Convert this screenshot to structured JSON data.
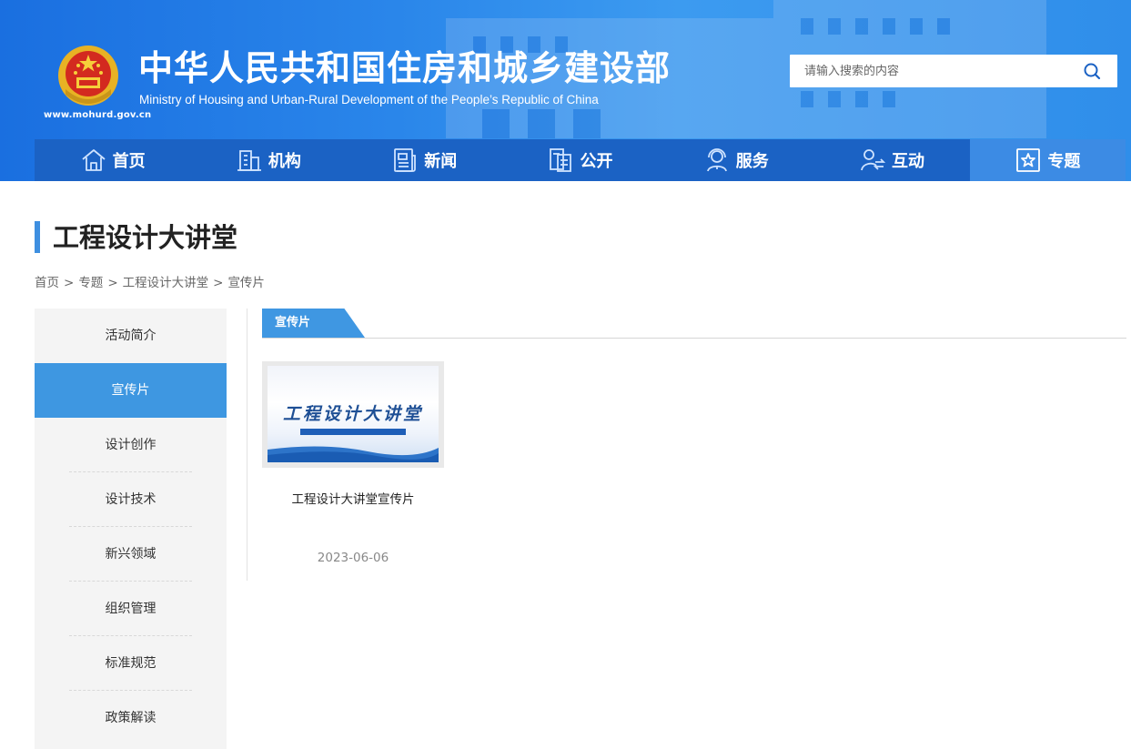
{
  "header": {
    "site_title": "中华人民共和国住房和城乡建设部",
    "site_subtitle": "Ministry of Housing and Urban-Rural Development of the People’s Republic of China",
    "site_url": "www.mohurd.gov.cn",
    "search_placeholder": "请输入搜索的内容",
    "brand_color": "#1b62c4"
  },
  "nav": {
    "items": [
      {
        "label": "首页",
        "icon": "home-icon"
      },
      {
        "label": "机构",
        "icon": "building-icon"
      },
      {
        "label": "新闻",
        "icon": "news-icon"
      },
      {
        "label": "公开",
        "icon": "documents-icon"
      },
      {
        "label": "服务",
        "icon": "service-icon"
      },
      {
        "label": "互动",
        "icon": "interaction-icon"
      },
      {
        "label": "专题",
        "icon": "star-icon"
      }
    ],
    "active": "专题"
  },
  "page": {
    "title": "工程设计大讲堂",
    "breadcrumb": [
      "首页",
      "专题",
      "工程设计大讲堂",
      "宣传片"
    ]
  },
  "sidebar": {
    "items": [
      {
        "label": "活动简介"
      },
      {
        "label": "宣传片"
      },
      {
        "label": "设计创作"
      },
      {
        "label": "设计技术"
      },
      {
        "label": "新兴领域"
      },
      {
        "label": "组织管理"
      },
      {
        "label": "标准规范"
      },
      {
        "label": "政策解读"
      }
    ],
    "active": "宣传片",
    "accent_color": "#3e97e1"
  },
  "content": {
    "tab_label": "宣传片",
    "items": [
      {
        "title": "工程设计大讲堂宣传片",
        "date": "2023-06-06",
        "thumb_text": "工程设计大讲堂"
      }
    ]
  }
}
